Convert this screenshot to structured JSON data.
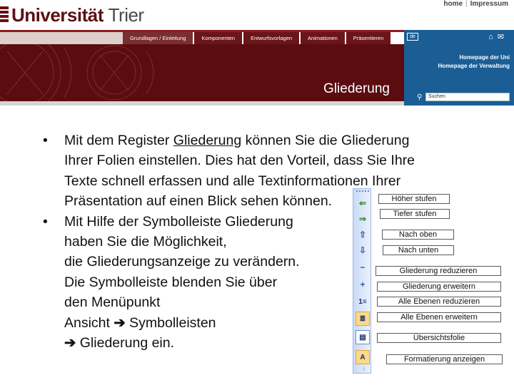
{
  "header": {
    "logo_primary": "Universität",
    "logo_secondary": "Trier",
    "toplinks": [
      "home",
      "Impressum"
    ],
    "nav_tabs": [
      "Grundlagen / Einleitung",
      "Komponenten",
      "Entwurfsvorlagen",
      "Animationen",
      "Präsentieren"
    ],
    "active_tab": 0,
    "banner_title": "Gliederung",
    "lang": "de",
    "panel_links": [
      "Homepage der Uni",
      "Homepage der Verwaltung"
    ],
    "search_placeholder": "Suchen",
    "colors": {
      "brand": "#5a0c10",
      "panel": "#1b5e96",
      "nav": "#6b1518"
    }
  },
  "content": {
    "bullet1": {
      "prefix": "Mit dem Register ",
      "link": "Gliederung",
      "line1_rest": " können Sie die Gliederung",
      "line2": "Ihrer Folien einstellen. Dies hat den Vorteil, dass Sie Ihre",
      "line3": "Texte schnell erfassen und alle Textinformationen Ihrer",
      "line4": "Präsentation auf einen Blick sehen können."
    },
    "bullet2": {
      "line1": "Mit Hilfe der Symbolleiste Gliederung",
      "line2": "haben Sie die Möglichkeit,",
      "line3": "die Gliederungsanzeige zu verändern.",
      "line4": "Die Symbolleiste blenden Sie über",
      "line5": "den Menüpunkt",
      "line6_a": "Ansicht",
      "line6_b": "Symbolleisten",
      "line7": "Gliederung ein."
    },
    "bullet_glyph": "•",
    "arrow_glyph": "➔"
  },
  "toolbar": {
    "buttons": [
      {
        "icon": "promote-arrow-icon",
        "glyph": "⇐",
        "label": "Höher stufen"
      },
      {
        "icon": "demote-arrow-icon",
        "glyph": "⇒",
        "label": "Tiefer stufen"
      },
      {
        "icon": "move-up-icon",
        "glyph": "⇧",
        "label": "Nach oben"
      },
      {
        "icon": "move-down-icon",
        "glyph": "⇩",
        "label": "Nach unten"
      },
      {
        "icon": "collapse-icon",
        "glyph": "−",
        "label": "Gliederung reduzieren"
      },
      {
        "icon": "expand-icon",
        "glyph": "+",
        "label": "Gliederung erweitern"
      },
      {
        "icon": "collapse-all-icon",
        "glyph": "1≡",
        "label": "Alle Ebenen reduzieren"
      },
      {
        "icon": "expand-all-icon",
        "glyph": "≣",
        "label": "Alle Ebenen erweitern"
      },
      {
        "icon": "summary-slide-icon",
        "glyph": "▤",
        "label": "Übersichtsfolie"
      },
      {
        "icon": "show-formatting-icon",
        "glyph": "A",
        "label": "Formatierung anzeigen"
      }
    ],
    "footer_glyph": "⁞"
  }
}
